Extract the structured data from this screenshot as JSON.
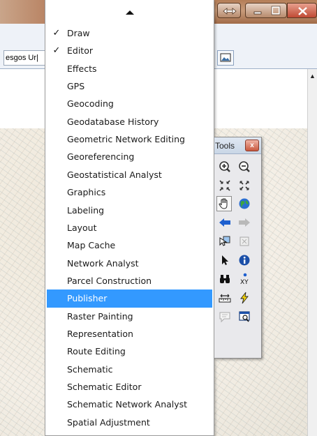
{
  "app": {
    "layer_dropdown_value": "esgos Ur|"
  },
  "menu": {
    "items": [
      {
        "label": "Draw",
        "checked": true
      },
      {
        "label": "Editor",
        "checked": true
      },
      {
        "label": "Effects",
        "checked": false
      },
      {
        "label": "GPS",
        "checked": false
      },
      {
        "label": "Geocoding",
        "checked": false
      },
      {
        "label": "Geodatabase History",
        "checked": false
      },
      {
        "label": "Geometric Network Editing",
        "checked": false
      },
      {
        "label": "Georeferencing",
        "checked": false
      },
      {
        "label": "Geostatistical Analyst",
        "checked": false
      },
      {
        "label": "Graphics",
        "checked": false
      },
      {
        "label": "Labeling",
        "checked": false
      },
      {
        "label": "Layout",
        "checked": false
      },
      {
        "label": "Map Cache",
        "checked": false
      },
      {
        "label": "Network Analyst",
        "checked": false
      },
      {
        "label": "Parcel Construction",
        "checked": false
      },
      {
        "label": "Publisher",
        "checked": false,
        "selected": true
      },
      {
        "label": "Raster Painting",
        "checked": false
      },
      {
        "label": "Representation",
        "checked": false
      },
      {
        "label": "Route Editing",
        "checked": false
      },
      {
        "label": "Schematic",
        "checked": false
      },
      {
        "label": "Schematic Editor",
        "checked": false
      },
      {
        "label": "Schematic Network Analyst",
        "checked": false
      },
      {
        "label": "Spatial Adjustment",
        "checked": false
      }
    ],
    "check_glyph": "✓",
    "selected_color": "#3399ff"
  },
  "tools_toolbar": {
    "title": "Tools",
    "close_glyph": "x",
    "tools": [
      {
        "icon": "zoom-in-icon"
      },
      {
        "icon": "zoom-out-icon"
      },
      {
        "icon": "fixed-zoom-in-icon"
      },
      {
        "icon": "fixed-zoom-out-icon"
      },
      {
        "icon": "pan-hand-icon",
        "pressed": true
      },
      {
        "icon": "full-extent-globe-icon"
      },
      {
        "icon": "back-arrow-icon"
      },
      {
        "icon": "forward-arrow-icon"
      },
      {
        "icon": "select-features-icon"
      },
      {
        "icon": "clear-selection-icon"
      },
      {
        "icon": "select-elements-pointer-icon"
      },
      {
        "icon": "identify-icon"
      },
      {
        "icon": "find-binoculars-icon"
      },
      {
        "icon": "go-to-xy-icon"
      },
      {
        "icon": "measure-icon"
      },
      {
        "icon": "hyperlink-lightning-icon"
      },
      {
        "icon": "html-popup-icon"
      },
      {
        "icon": "viewer-window-icon"
      }
    ],
    "xy_label": "XY"
  }
}
